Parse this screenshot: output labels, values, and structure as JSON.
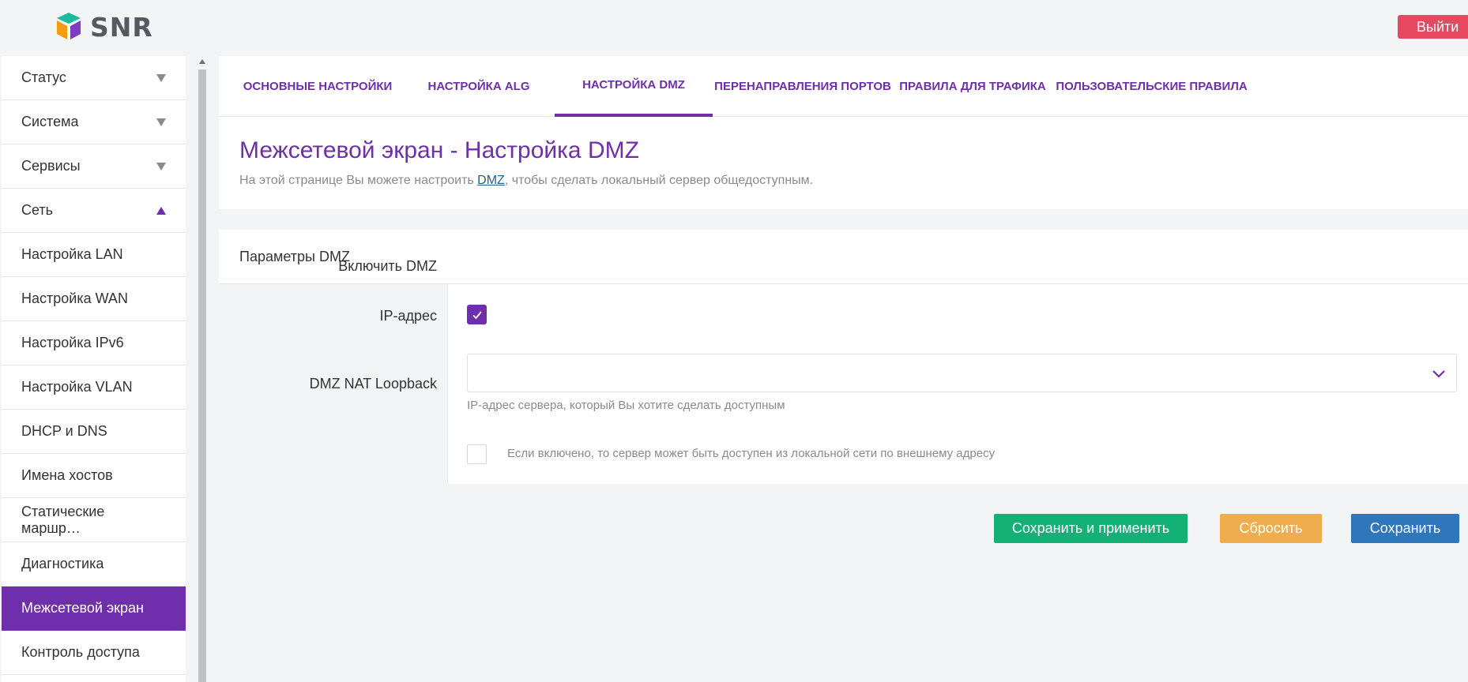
{
  "header": {
    "logo_text": "SNR",
    "logout_label": "Выйти"
  },
  "sidebar": {
    "items": [
      {
        "label": "Статус",
        "caret": "down"
      },
      {
        "label": "Система",
        "caret": "down"
      },
      {
        "label": "Сервисы",
        "caret": "down"
      },
      {
        "label": "Сеть",
        "caret": "up"
      },
      {
        "label": "Настройка LAN"
      },
      {
        "label": "Настройка WAN"
      },
      {
        "label": "Настройка IPv6"
      },
      {
        "label": "Настройка VLAN"
      },
      {
        "label": "DHCP и DNS"
      },
      {
        "label": "Имена хостов"
      },
      {
        "label": "Статические маршр…"
      },
      {
        "label": "Диагностика"
      },
      {
        "label": "Межсетевой экран",
        "active": true
      },
      {
        "label": "Контроль доступа"
      }
    ]
  },
  "tabs": [
    {
      "label": "ОСНОВНЫЕ НАСТРОЙКИ"
    },
    {
      "label": "НАСТРОЙКА ALG"
    },
    {
      "label": "НАСТРОЙКА DMZ",
      "active": true
    },
    {
      "label": "ПЕРЕНАПРАВЛЕНИЯ ПОРТОВ"
    },
    {
      "label": "ПРАВИЛА ДЛЯ ТРАФИКА"
    },
    {
      "label": "ПОЛЬЗОВАТЕЛЬСКИЕ ПРАВИЛА"
    }
  ],
  "page": {
    "title": "Межсетевой экран - Настройка DMZ",
    "desc_before": "На этой странице Вы можете настроить ",
    "desc_link": "DMZ",
    "desc_after": ", чтобы сделать локальный сервер общедоступным."
  },
  "panel": {
    "header": "Параметры DMZ",
    "enable_label": "Включить DMZ",
    "enable_checked": true,
    "ip_label": "IP-адрес",
    "ip_value": "",
    "ip_hint": "IP-адрес сервера, который Вы хотите сделать доступным",
    "loopback_label": "DMZ NAT Loopback",
    "loopback_checked": false,
    "loopback_hint": "Если включено, то сервер может быть доступен из локальной сети по внешнему адресу"
  },
  "actions": {
    "save_apply": "Сохранить и применить",
    "reset": "Сбросить",
    "save": "Сохранить"
  },
  "colors": {
    "accent": "#6f2eab",
    "logout": "#e5485f",
    "save_apply": "#14b177",
    "reset": "#f0ad4e",
    "save": "#2e77bb"
  }
}
